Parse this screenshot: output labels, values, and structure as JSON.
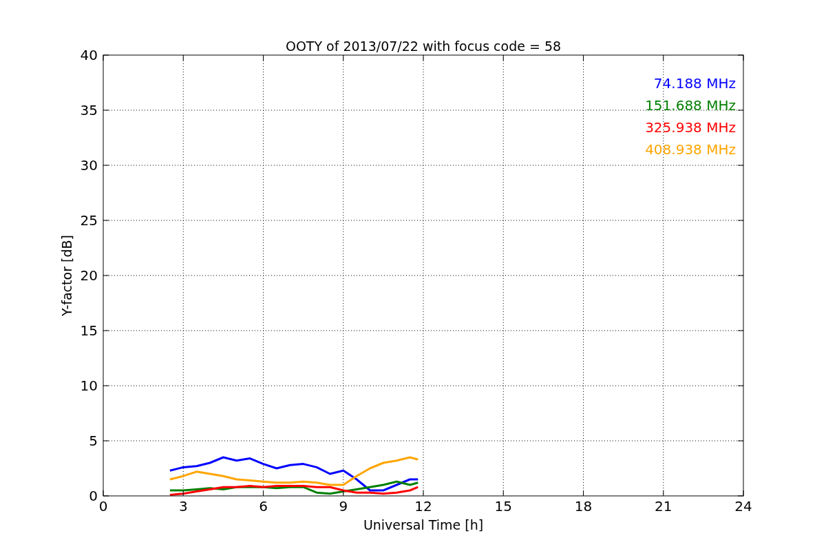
{
  "chart_data": {
    "type": "line",
    "title": "OOTY of 2013/07/22 with focus code = 58",
    "xlabel": "Universal Time [h]",
    "ylabel": "Y-factor [dB]",
    "x": [
      2.5,
      3,
      3.5,
      4,
      4.5,
      5,
      5.5,
      6,
      6.5,
      7,
      7.5,
      8,
      8.5,
      9,
      9.5,
      10,
      10.5,
      11,
      11.5,
      11.8
    ],
    "series": [
      {
        "name": "74.188 MHz",
        "color": "#0000ff",
        "values": [
          2.3,
          2.6,
          2.7,
          3.0,
          3.5,
          3.2,
          3.4,
          2.9,
          2.5,
          2.8,
          2.9,
          2.6,
          2.0,
          2.3,
          1.5,
          0.5,
          0.5,
          1.0,
          1.5,
          1.5
        ]
      },
      {
        "name": "151.688 MHz",
        "color": "#008000",
        "values": [
          0.5,
          0.5,
          0.6,
          0.7,
          0.6,
          0.8,
          0.8,
          0.8,
          0.7,
          0.8,
          0.8,
          0.3,
          0.2,
          0.4,
          0.6,
          0.8,
          1.0,
          1.3,
          1.0,
          1.2
        ]
      },
      {
        "name": "325.938 MHz",
        "color": "#ff0000",
        "values": [
          0.1,
          0.2,
          0.4,
          0.6,
          0.8,
          0.8,
          0.9,
          0.8,
          0.9,
          0.9,
          0.9,
          0.8,
          0.8,
          0.5,
          0.3,
          0.3,
          0.2,
          0.3,
          0.5,
          0.8
        ]
      },
      {
        "name": "408.938 MHz",
        "color": "#ffa500",
        "values": [
          1.5,
          1.8,
          2.2,
          2.0,
          1.8,
          1.5,
          1.4,
          1.3,
          1.2,
          1.2,
          1.3,
          1.2,
          1.0,
          1.0,
          1.8,
          2.5,
          3.0,
          3.2,
          3.5,
          3.3
        ]
      }
    ],
    "grid": true,
    "xlim": [
      0,
      24
    ],
    "ylim": [
      0,
      40
    ],
    "xticks": [
      0,
      3,
      6,
      9,
      12,
      15,
      18,
      21,
      24
    ],
    "yticks": [
      0,
      5,
      10,
      15,
      20,
      25,
      30,
      35,
      40
    ]
  }
}
